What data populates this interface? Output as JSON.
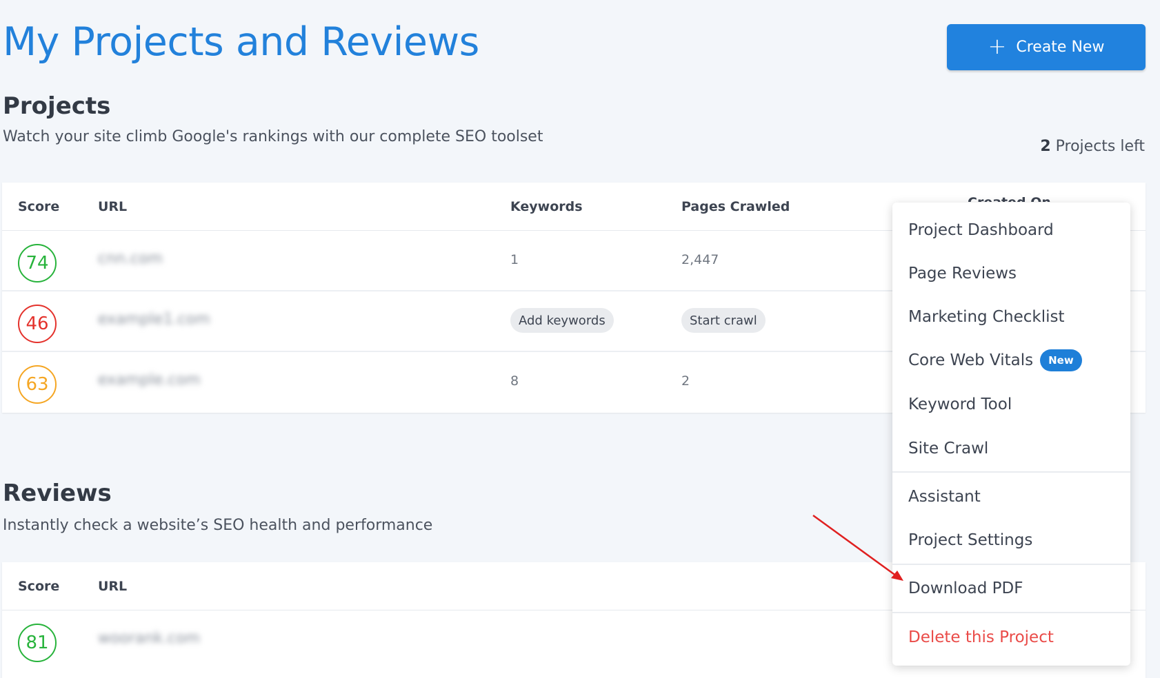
{
  "header": {
    "title": "My Projects and Reviews",
    "create_label": "Create New"
  },
  "projects": {
    "title": "Projects",
    "subtitle": "Watch your site climb Google's rankings with our complete SEO toolset",
    "left_count": "2",
    "left_label": "Projects left",
    "columns": {
      "score": "Score",
      "url": "URL",
      "keywords": "Keywords",
      "pages_crawled": "Pages Crawled",
      "created_on": "Created On"
    },
    "rows": [
      {
        "score": "74",
        "url": "cnn.com",
        "keywords": "1",
        "pages": "2,447"
      },
      {
        "score": "46",
        "url": "example1.com",
        "keywords_action": "Add keywords",
        "pages_action": "Start crawl"
      },
      {
        "score": "63",
        "url": "example.com",
        "keywords": "8",
        "pages": "2"
      }
    ]
  },
  "reviews": {
    "title": "Reviews",
    "subtitle": "Instantly check a website’s SEO health and performance",
    "columns": {
      "score": "Score",
      "url": "URL"
    },
    "rows": [
      {
        "score": "81",
        "url": "woorank.com"
      }
    ]
  },
  "menu": {
    "items": [
      "Project Dashboard",
      "Page Reviews",
      "Marketing Checklist",
      "Core Web Vitals",
      "Keyword Tool",
      "Site Crawl",
      "Assistant",
      "Project Settings",
      "Download PDF",
      "Delete this Project"
    ],
    "new_badge": "New"
  },
  "colors": {
    "accent": "#2182de",
    "score_good": "#27b33b",
    "score_bad": "#e4322c",
    "score_medium": "#f5a623",
    "danger": "#ea4b48",
    "annotation_arrow": "#e02020"
  }
}
